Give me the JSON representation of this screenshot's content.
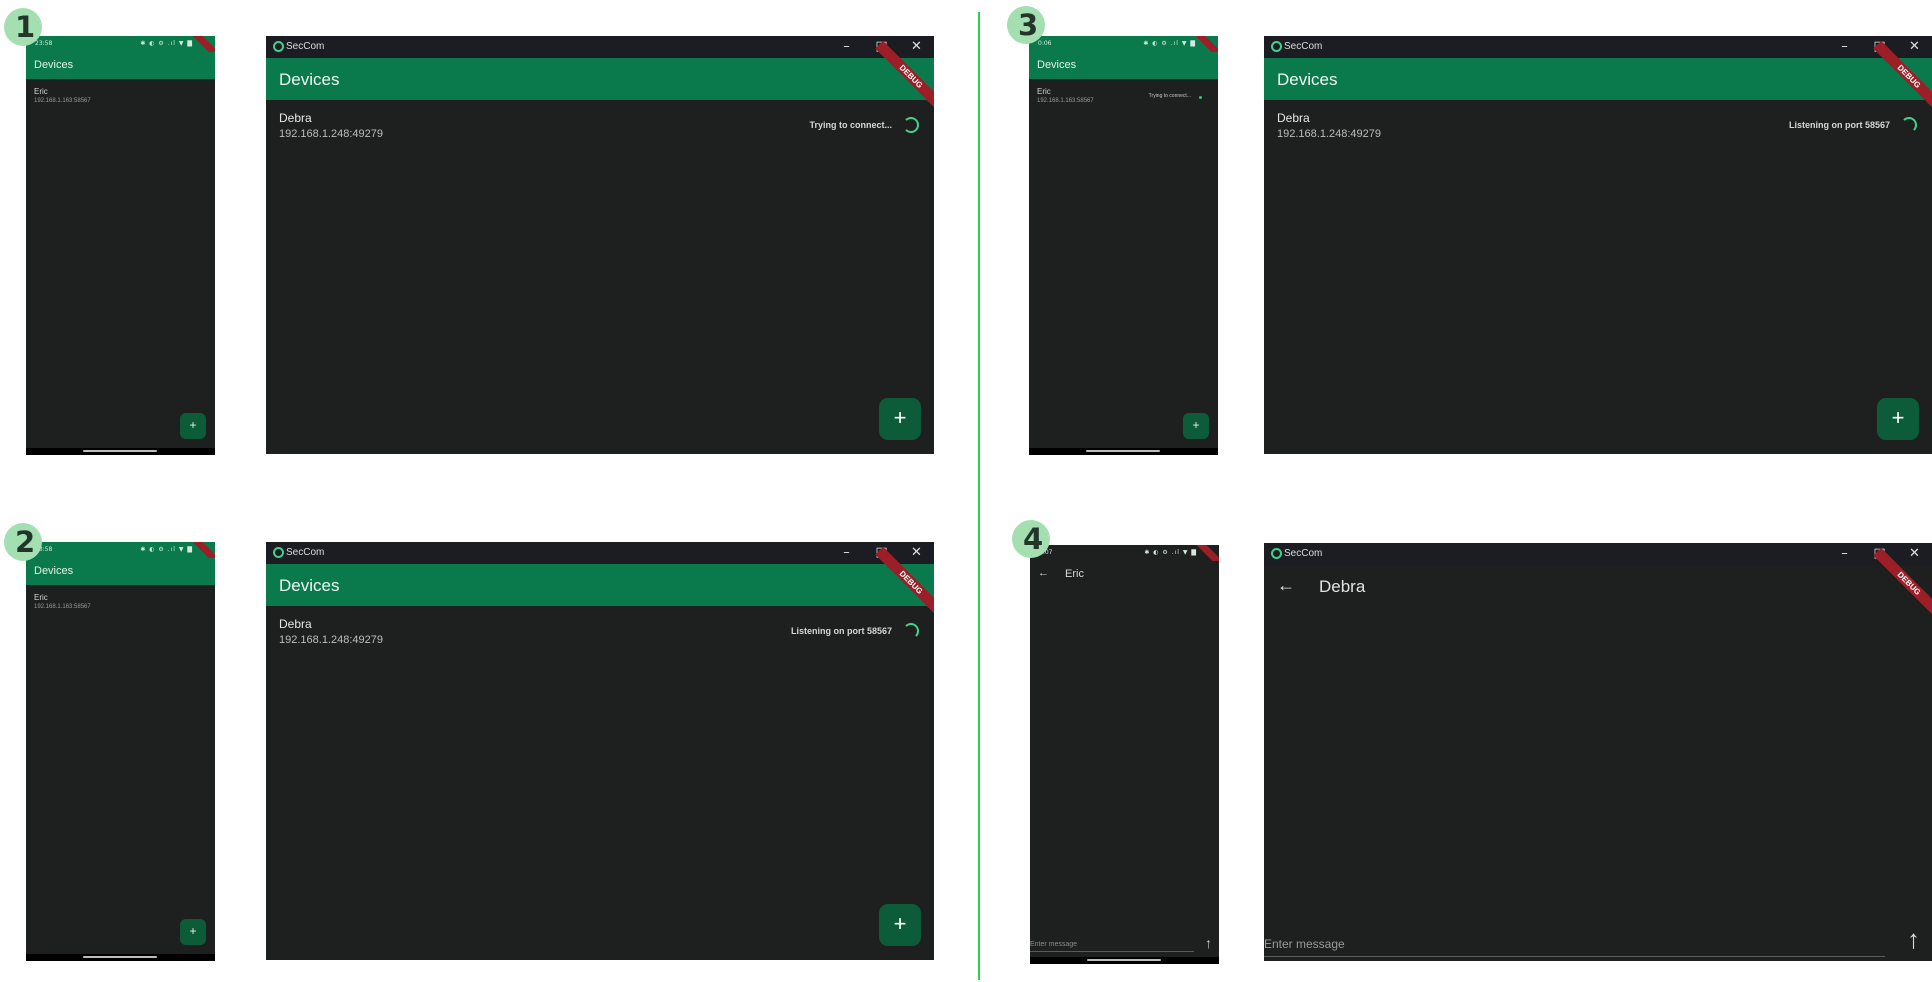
{
  "panels": [
    {
      "step": "1",
      "phone": {
        "time": "23:58",
        "status_icons": "✱ ◐ ⚙ .ıl ▼ ▇",
        "title": "Devices",
        "device_name": "Eric",
        "device_addr": "192.168.1.163:58567",
        "fab": "+"
      },
      "desktop": {
        "window_title": "SecCom",
        "title": "Devices",
        "device_name": "Debra",
        "device_addr": "192.168.1.248:49279",
        "status": "Trying to connect...",
        "fab": "+"
      }
    },
    {
      "step": "2",
      "phone": {
        "time": "23:58",
        "status_icons": "✱ ◐ ⚙ .ıl ▼ ▇",
        "title": "Devices",
        "device_name": "Eric",
        "device_addr": "192.168.1.163:58567",
        "fab": "+"
      },
      "desktop": {
        "window_title": "SecCom",
        "title": "Devices",
        "device_name": "Debra",
        "device_addr": "192.168.1.248:49279",
        "status": "Listening on port 58567",
        "fab": "+"
      }
    },
    {
      "step": "3",
      "phone": {
        "time": "0:06",
        "status_icons": "✱ ◐ ⚙ .ıl ▼ ▇",
        "title": "Devices",
        "device_name": "Eric",
        "device_addr": "192.168.1.163:58567",
        "status": "Trying to connect...",
        "fab": "+"
      },
      "desktop": {
        "window_title": "SecCom",
        "title": "Devices",
        "device_name": "Debra",
        "device_addr": "192.168.1.248:49279",
        "status": "Listening on port 58567",
        "fab": "+"
      }
    },
    {
      "step": "4",
      "phone": {
        "time": "0:07",
        "status_icons": "✱ ◐ ⚙ .ıl ▼ ▇",
        "chat_title": "Eric",
        "input_placeholder": "Enter message"
      },
      "desktop": {
        "window_title": "SecCom",
        "chat_title": "Debra",
        "input_placeholder": "Enter message"
      }
    }
  ],
  "window_controls": {
    "minimize": "–",
    "maximize": "□",
    "close": "✕"
  },
  "debug_banner": "DEBUG",
  "icons": {
    "back": "←",
    "send": "↑",
    "app_logo": "seccom-logo-icon"
  },
  "colors": {
    "appbar": "#0a7a4c",
    "fab": "#0c5c39",
    "spinner": "#47d08c",
    "background": "#1e1f1f",
    "divider": "#2fd04f",
    "badge": "#a3dfb1"
  }
}
